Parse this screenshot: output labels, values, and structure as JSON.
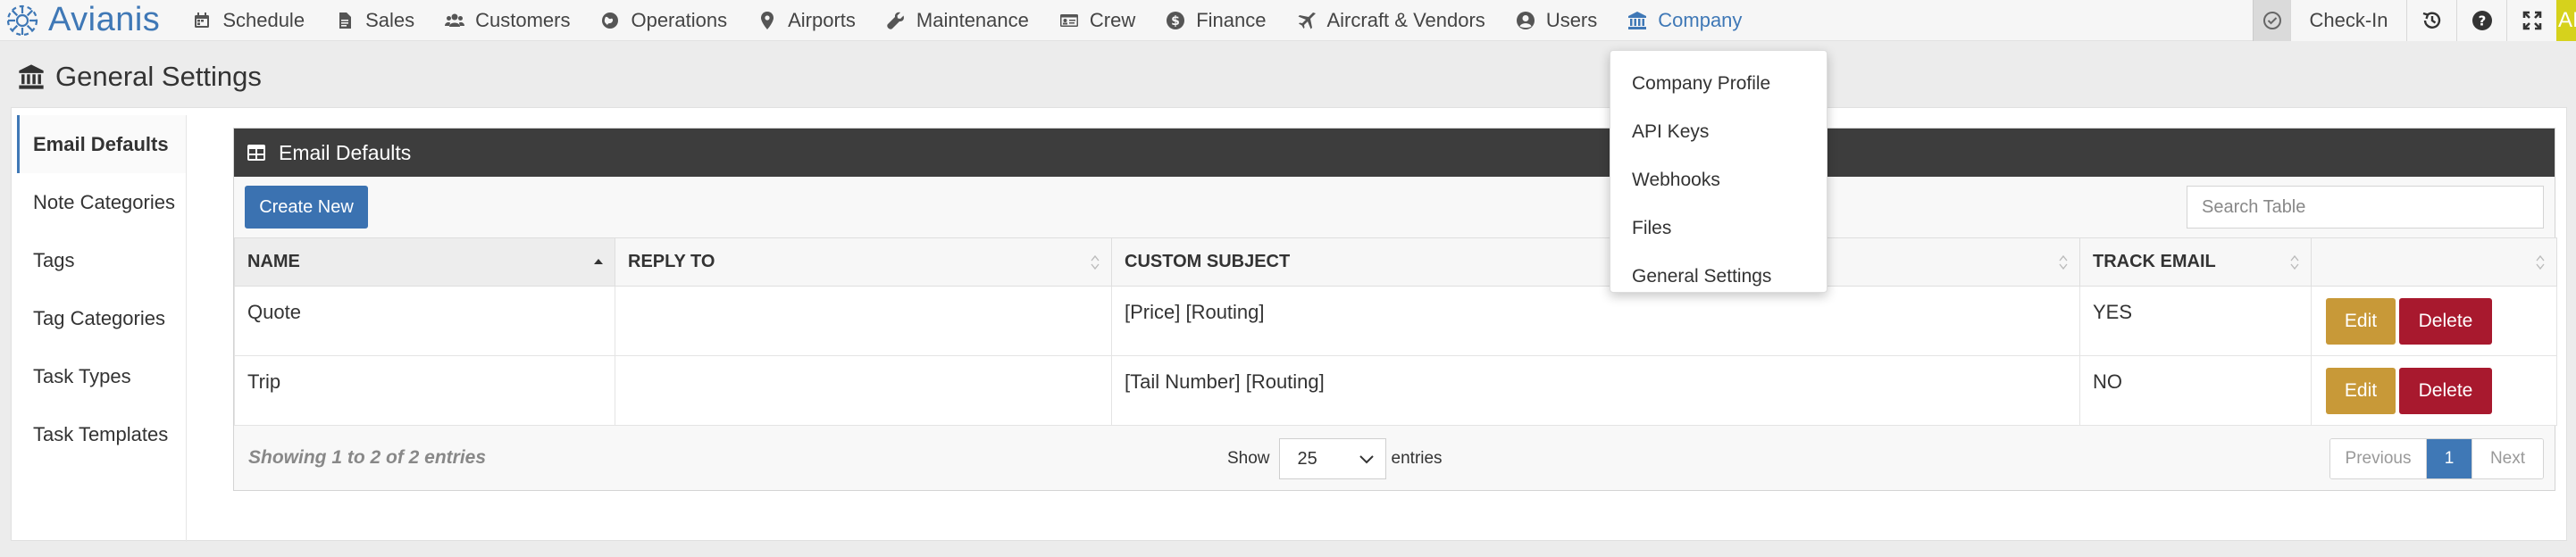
{
  "brand": {
    "name": "Avianis",
    "logo_icon": "avianis-logo-icon"
  },
  "nav": {
    "items": [
      {
        "label": "Schedule",
        "icon": "calendar-icon"
      },
      {
        "label": "Sales",
        "icon": "file-icon"
      },
      {
        "label": "Customers",
        "icon": "users-icon"
      },
      {
        "label": "Operations",
        "icon": "globe-icon"
      },
      {
        "label": "Airports",
        "icon": "map-pin-icon"
      },
      {
        "label": "Maintenance",
        "icon": "wrench-icon"
      },
      {
        "label": "Crew",
        "icon": "id-card-icon"
      },
      {
        "label": "Finance",
        "icon": "dollar-icon"
      },
      {
        "label": "Aircraft & Vendors",
        "icon": "plane-icon"
      },
      {
        "label": "Users",
        "icon": "user-circle-icon"
      },
      {
        "label": "Company",
        "icon": "bank-icon",
        "active": true
      }
    ],
    "active_color": "#3f78b6"
  },
  "topright": {
    "checkin_label": "Check-In",
    "avatar_text": "AI"
  },
  "page": {
    "title": "General Settings"
  },
  "sidebar": {
    "items": [
      {
        "label": "Email Defaults",
        "active": true
      },
      {
        "label": "Note Categories"
      },
      {
        "label": "Tags"
      },
      {
        "label": "Tag Categories"
      },
      {
        "label": "Task Types"
      },
      {
        "label": "Task Templates"
      }
    ]
  },
  "card": {
    "title": "Email Defaults",
    "create_label": "Create New",
    "search_placeholder": "Search Table",
    "columns": [
      "NAME",
      "REPLY TO",
      "CUSTOM SUBJECT",
      "TRACK EMAIL",
      ""
    ],
    "rows": [
      {
        "name": "Quote",
        "reply_to": "",
        "subject": "[Price] [Routing]",
        "track": "YES"
      },
      {
        "name": "Trip",
        "reply_to": "",
        "subject": "[Tail Number] [Routing]",
        "track": "NO"
      }
    ],
    "edit_label": "Edit",
    "delete_label": "Delete",
    "info": "Showing 1 to 2 of 2 entries",
    "show_label": "Show",
    "page_size": "25",
    "entries_label": "entries",
    "pager": {
      "prev": "Previous",
      "current": "1",
      "next": "Next"
    }
  },
  "dropdown": {
    "items": [
      "Company Profile",
      "API Keys",
      "Webhooks",
      "Files",
      "General Settings"
    ]
  },
  "colors": {
    "primary": "#3b72b1",
    "edit": "#c89938",
    "delete": "#a8192e",
    "card_header": "#3d3d3d"
  }
}
